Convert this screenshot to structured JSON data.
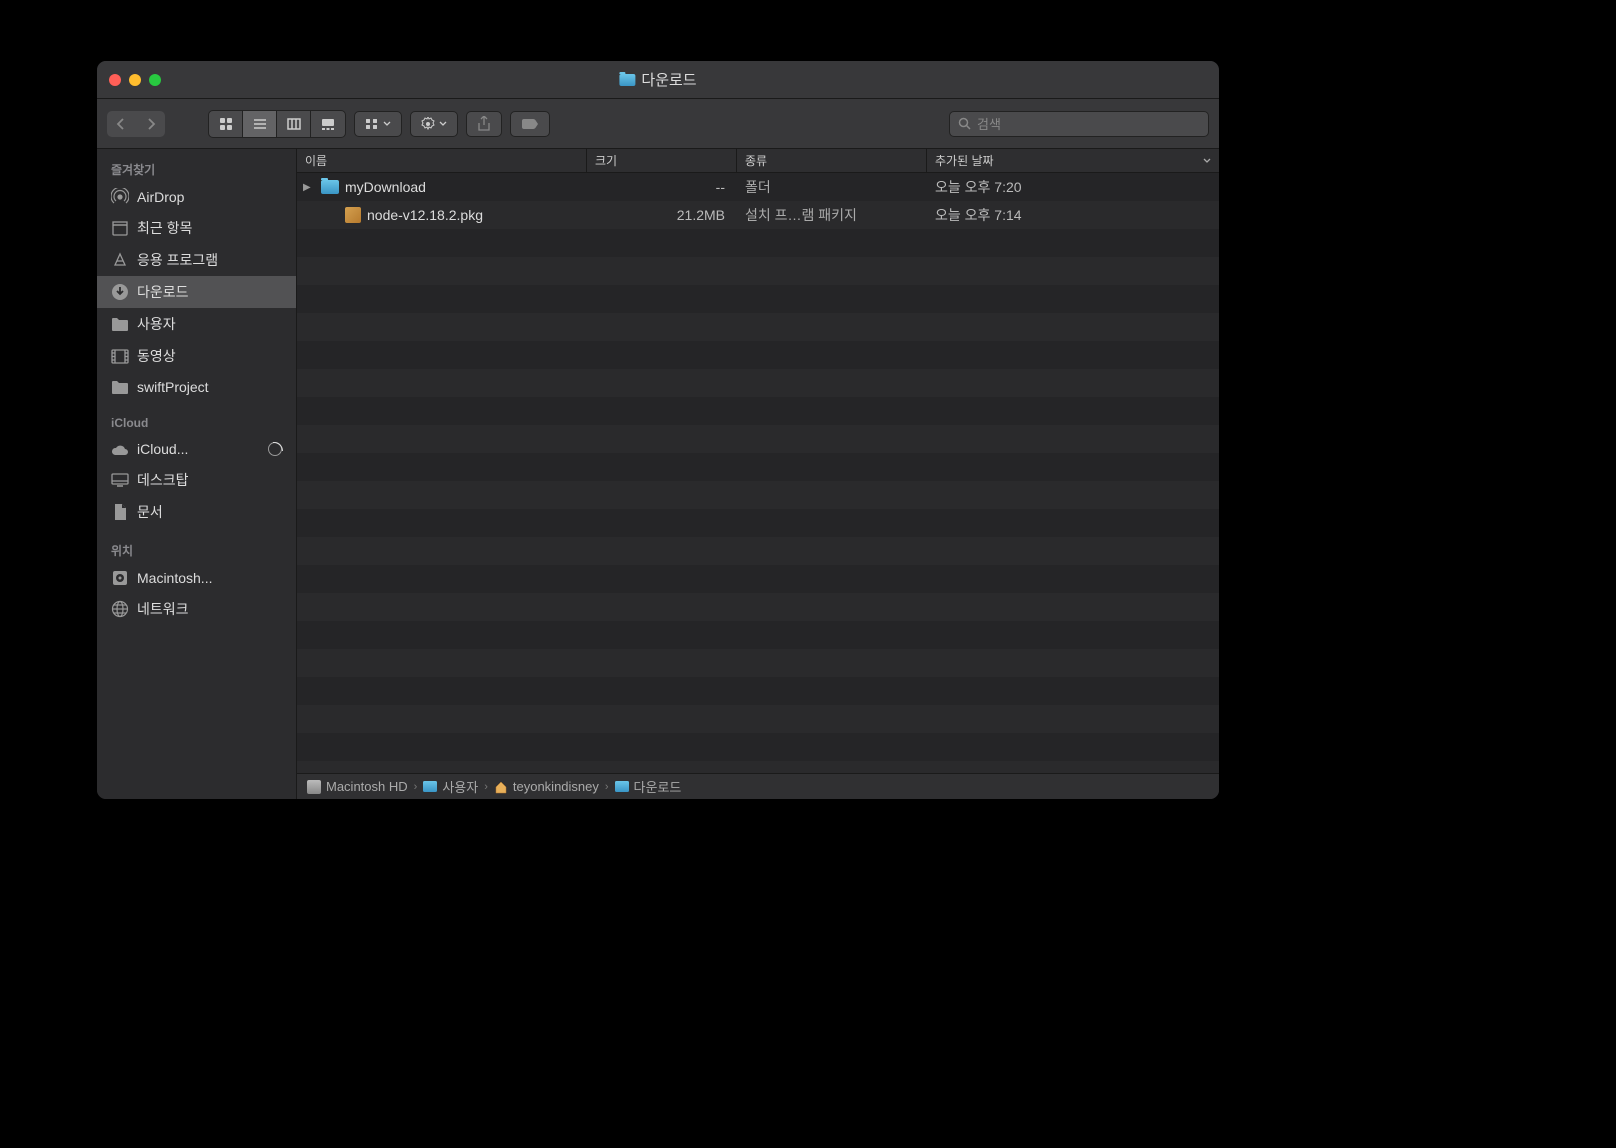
{
  "window": {
    "title": "다운로드"
  },
  "toolbar": {
    "search_placeholder": "검색"
  },
  "sidebar": {
    "sections": [
      {
        "header": "즐겨찾기",
        "items": [
          {
            "label": "AirDrop",
            "icon": "airdrop"
          },
          {
            "label": "최근 항목",
            "icon": "recents"
          },
          {
            "label": "응용 프로그램",
            "icon": "applications"
          },
          {
            "label": "다운로드",
            "icon": "downloads",
            "selected": true
          },
          {
            "label": "사용자",
            "icon": "folder"
          },
          {
            "label": "동영상",
            "icon": "movies"
          },
          {
            "label": "swiftProject",
            "icon": "folder"
          }
        ]
      },
      {
        "header": "iCloud",
        "items": [
          {
            "label": "iCloud...",
            "icon": "icloud",
            "badge": "pie"
          },
          {
            "label": "데스크탑",
            "icon": "desktop"
          },
          {
            "label": "문서",
            "icon": "documents"
          }
        ]
      },
      {
        "header": "위치",
        "items": [
          {
            "label": "Macintosh...",
            "icon": "disk"
          },
          {
            "label": "네트워크",
            "icon": "network"
          }
        ]
      }
    ]
  },
  "columns": {
    "name": "이름",
    "size": "크기",
    "kind": "종류",
    "date": "추가된 날짜"
  },
  "files": [
    {
      "name": "myDownload",
      "size": "--",
      "kind": "폴더",
      "date": "오늘 오후 7:20",
      "type": "folder",
      "expandable": true
    },
    {
      "name": "node-v12.18.2.pkg",
      "size": "21.2MB",
      "kind": "설치 프…램 패키지",
      "date": "오늘 오후 7:14",
      "type": "pkg",
      "indent": true
    }
  ],
  "pathbar": [
    {
      "label": "Macintosh HD",
      "icon": "disk"
    },
    {
      "label": "사용자",
      "icon": "folder"
    },
    {
      "label": "teyonkindisney",
      "icon": "home"
    },
    {
      "label": "다운로드",
      "icon": "folder"
    }
  ]
}
